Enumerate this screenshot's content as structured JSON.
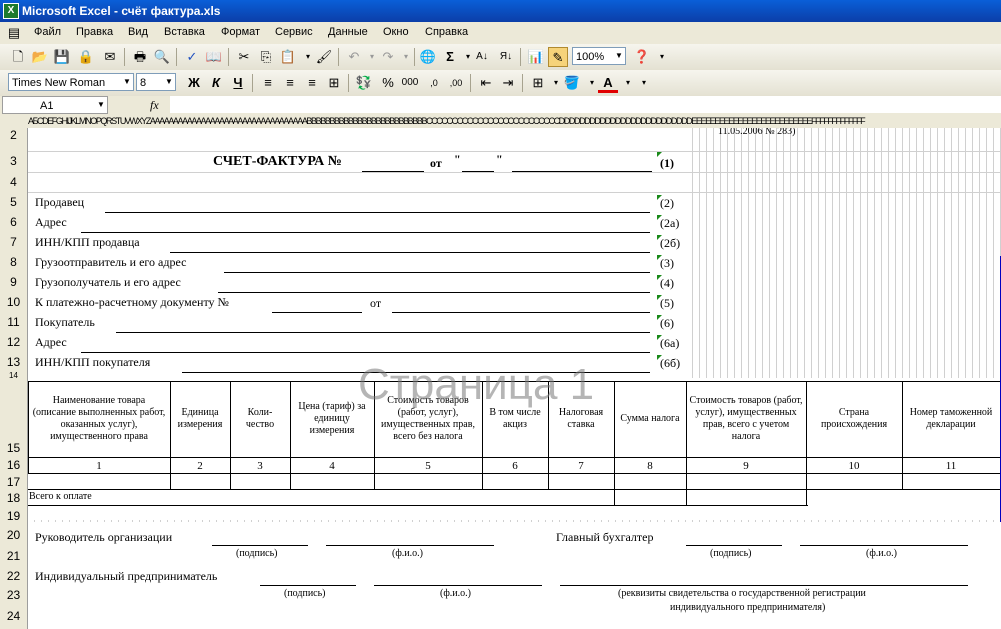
{
  "window": {
    "title": "Microsoft Excel - счёт фактура.xls"
  },
  "menu": [
    "Файл",
    "Правка",
    "Вид",
    "Вставка",
    "Формат",
    "Сервис",
    "Данные",
    "Окно",
    "Справка"
  ],
  "toolbar": {
    "zoom": "100%"
  },
  "format_toolbar": {
    "font": "Times New Roman",
    "size": "8",
    "bold": "Ж",
    "italic": "К",
    "underline": "Ч",
    "percent": "%",
    "thousands": "000",
    "font_color_letter": "A"
  },
  "formula_bar": {
    "name_box": "A1",
    "fx": "fx",
    "value": ""
  },
  "column_header_strip": "АБСDEFGHIJKLMNOPQRSTUVWXYZAAAAAAAAAAAAAAAAAAAAAAAAAAAAAAAAAABBBBBBBBBBBBBBBBBBBBBBBBBBCCCCCCCCCCCCCCCCCCCCCCCCCCDDDDDDDDDDDDDDDDDDDDDDDDDDEEEEEEEEEEEEEEEEEEEEEEEEEEFFFFFFFFFFFFF",
  "rows": [
    "2",
    "3",
    "4",
    "5",
    "6",
    "7",
    "8",
    "9",
    "10",
    "11",
    "12",
    "13",
    "14",
    "15",
    "16",
    "17",
    "18",
    "19",
    "20",
    "21",
    "22",
    "23",
    "24"
  ],
  "doc": {
    "top_note": "11.05.2006 № 283)",
    "title": "СЧЕТ-ФАКТУРА №",
    "ot": "от",
    "q1": "\"",
    "q2": "\"",
    "ref1": "(1)",
    "fields": [
      {
        "label": "Продавец",
        "ref": "(2)"
      },
      {
        "label": "Адрес",
        "ref": "(2а)"
      },
      {
        "label": "ИНН/КПП продавца",
        "ref": "(2б)"
      },
      {
        "label": "Грузоотправитель и его адрес",
        "ref": "(3)"
      },
      {
        "label": "Грузополучатель и его адрес",
        "ref": "(4)"
      },
      {
        "label": "К платежно-расчетному документу №",
        "ref": "(5)"
      },
      {
        "label": "Покупатель",
        "ref": "(6)"
      },
      {
        "label": "Адрес",
        "ref": "(6а)"
      },
      {
        "label": "ИНН/КПП покупателя",
        "ref": "(6б)"
      }
    ],
    "pay_ot": "от",
    "watermark": "Страница 1",
    "table_headers": [
      "Наименование товара (описание выполненных работ, оказанных услуг), имущественного права",
      "Единица измерения",
      "Коли-чество",
      "Цена (тариф) за единицу измерения",
      "Стоимость товаров (работ, услуг), имущественных прав, всего без налога",
      "В том числе акциз",
      "Налоговая ставка",
      "Сумма налога",
      "Стоимость товаров (работ, услуг), имущественных прав, всего с учетом налога",
      "Страна происхождения",
      "Номер таможенной декларации"
    ],
    "col_numbers": [
      "1",
      "2",
      "3",
      "4",
      "5",
      "6",
      "7",
      "8",
      "9",
      "10",
      "11"
    ],
    "total_label": "Всего к оплате",
    "head_label": "Руководитель организации",
    "chief_acc_label": "Главный бухгалтер",
    "sign": "(подпись)",
    "fio": "(ф.и.о.)",
    "ip_label": "Индивидуальный предприниматель",
    "ip_req": "(реквизиты свидетельства о государственной регистрации",
    "ip_req2": "индивидуального предпринимателя)"
  }
}
